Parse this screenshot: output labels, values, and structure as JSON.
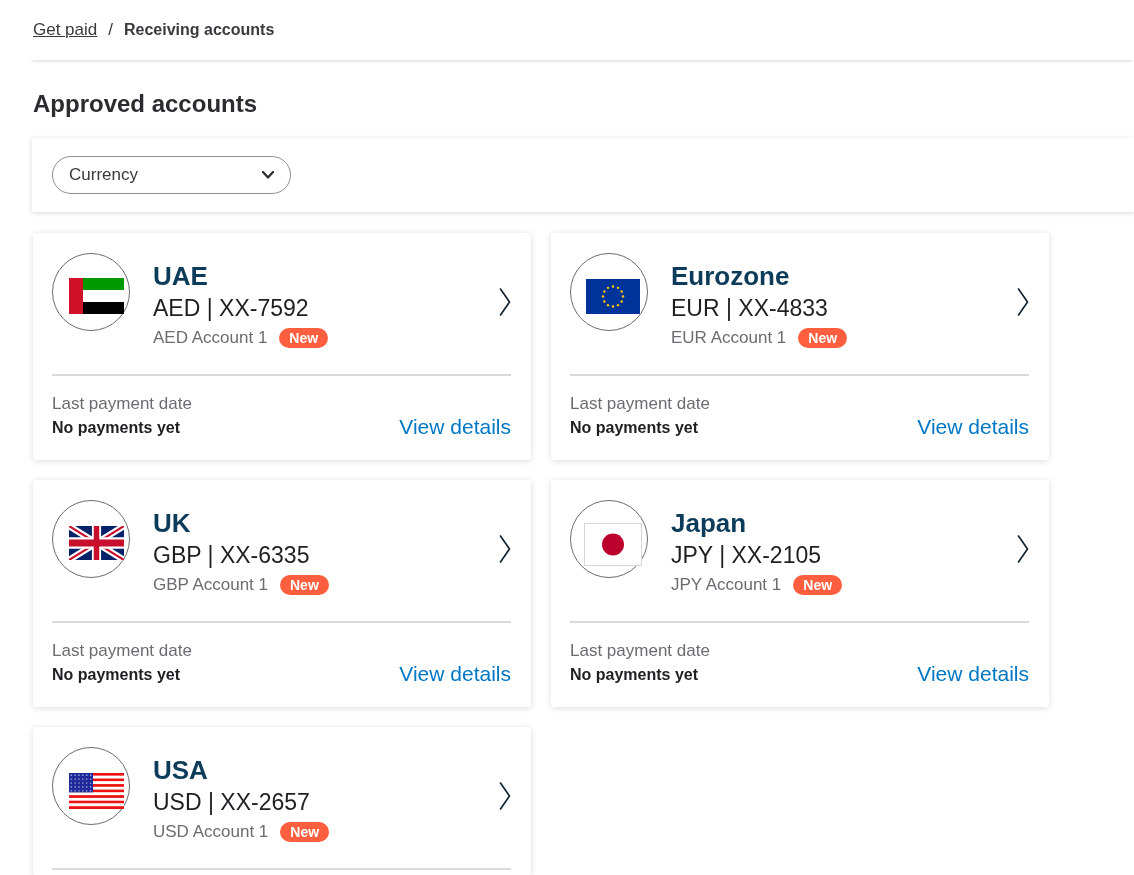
{
  "breadcrumb": {
    "items": [
      {
        "label": "Get paid",
        "kind": "link"
      },
      {
        "label": "Receiving accounts",
        "kind": "current"
      }
    ],
    "separator": "/"
  },
  "heading": "Approved accounts",
  "filter": {
    "label": "Currency"
  },
  "accounts": [
    {
      "kind": "ae",
      "region": "UAE",
      "number": "AED | XX-7592",
      "name": "AED Account 1",
      "badge": "New",
      "last_payment_label": "Last payment date",
      "last_payment": "No payments yet",
      "action": "View details"
    },
    {
      "kind": "eu",
      "region": "Eurozone",
      "number": "EUR | XX-4833",
      "name": "EUR Account 1",
      "badge": "New",
      "last_payment_label": "Last payment date",
      "last_payment": "No payments yet",
      "action": "View details"
    },
    {
      "kind": "gb",
      "region": "UK",
      "number": "GBP | XX-6335",
      "name": "GBP Account 1",
      "badge": "New",
      "last_payment_label": "Last payment date",
      "last_payment": "No payments yet",
      "action": "View details"
    },
    {
      "kind": "jp",
      "region": "Japan",
      "number": "JPY | XX-2105",
      "name": "JPY Account 1",
      "badge": "New",
      "last_payment_label": "Last payment date",
      "last_payment": "No payments yet",
      "action": "View details"
    },
    {
      "kind": "us",
      "region": "USA",
      "number": "USD | XX-2657",
      "name": "USD Account 1",
      "badge": "New"
    }
  ]
}
